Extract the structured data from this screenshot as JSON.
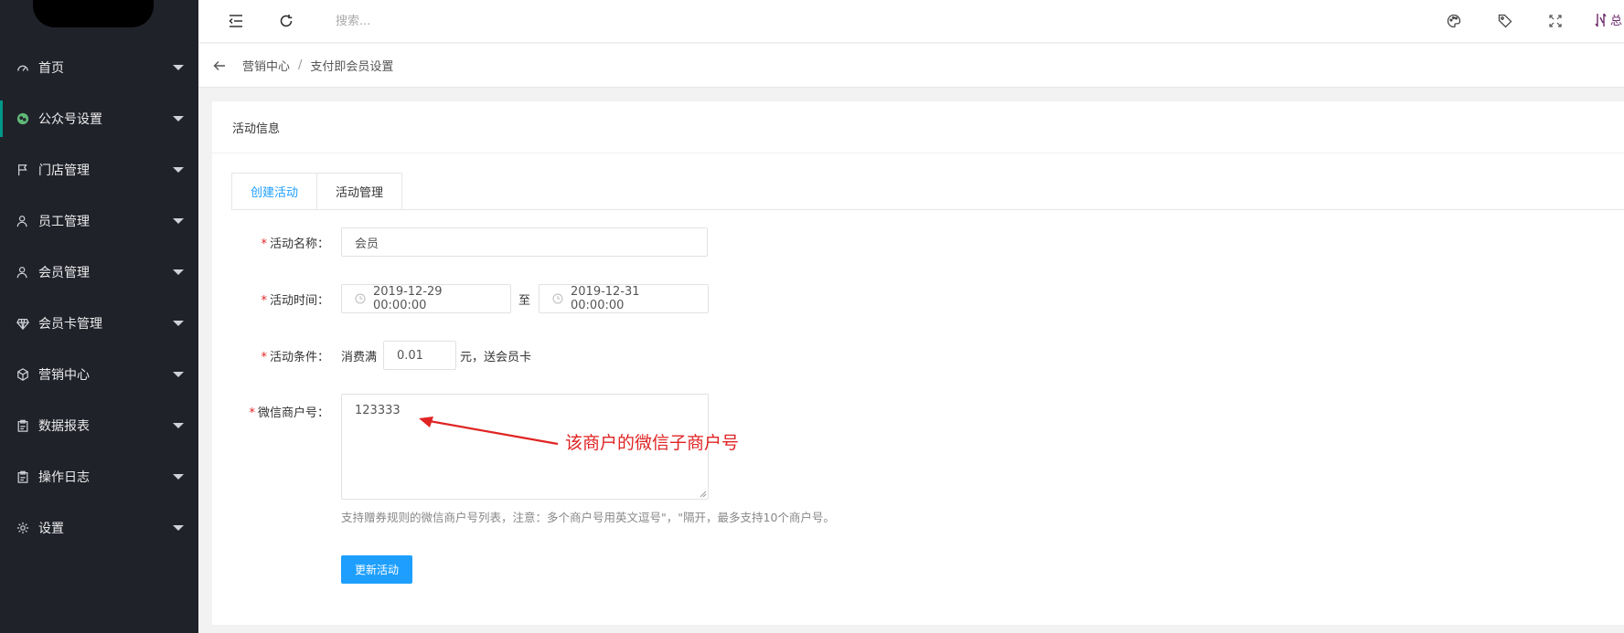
{
  "sidebar": {
    "items": [
      {
        "label": "首页",
        "icon": "gauge-icon"
      },
      {
        "label": "公众号设置",
        "icon": "wechat-icon"
      },
      {
        "label": "门店管理",
        "icon": "flag-icon"
      },
      {
        "label": "员工管理",
        "icon": "user-icon"
      },
      {
        "label": "会员管理",
        "icon": "user-icon"
      },
      {
        "label": "会员卡管理",
        "icon": "diamond-icon"
      },
      {
        "label": "营销中心",
        "icon": "cube-icon"
      },
      {
        "label": "数据报表",
        "icon": "clipboard-icon"
      },
      {
        "label": "操作日志",
        "icon": "clipboard-icon"
      },
      {
        "label": "设置",
        "icon": "gear-icon"
      }
    ],
    "active_index": 1
  },
  "header": {
    "search_placeholder": "搜索...",
    "user_text": "总"
  },
  "breadcrumb": {
    "parent": "营销中心",
    "separator": "/",
    "current": "支付即会员设置"
  },
  "card": {
    "title": "活动信息",
    "tabs": [
      {
        "label": "创建活动",
        "active": true
      },
      {
        "label": "活动管理",
        "active": false
      }
    ]
  },
  "form": {
    "required_mark": "*",
    "name_label": "活动名称：",
    "name_value": "会员",
    "time_label": "活动时间：",
    "start_time": "2019-12-29 00:00:00",
    "time_separator": "至",
    "end_time": "2019-12-31 00:00:00",
    "condition_label": "活动条件：",
    "condition_prefix": "消费满",
    "condition_amount": "0.01",
    "condition_suffix": "元，送会员卡",
    "merchant_label": "微信商户号：",
    "merchant_value": "123333",
    "merchant_hint": "支持赠券规则的微信商户号列表，注意：多个商户号用英文逗号\"，\"隔开，最多支持10个商户号。",
    "submit_label": "更新活动"
  },
  "annotation": {
    "text": "该商户的微信子商户号",
    "color": "#e02424"
  },
  "colors": {
    "sidebar_bg": "#20222a",
    "accent_blue": "#1e9fff",
    "active_bar": "#009688",
    "wechat_green": "#5fb878"
  }
}
